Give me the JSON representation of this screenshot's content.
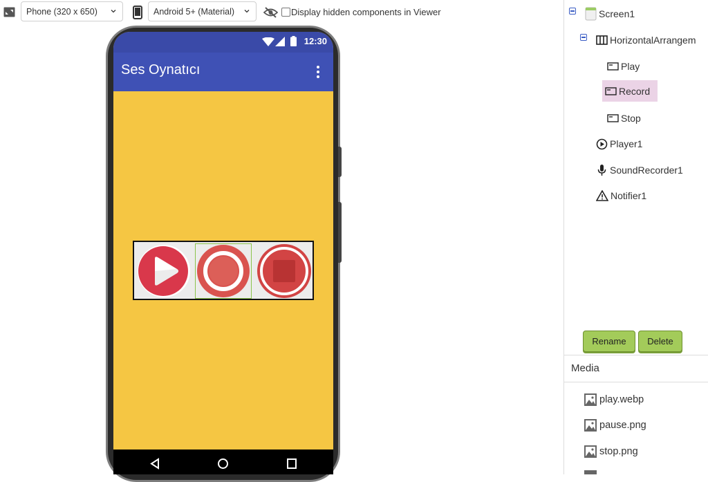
{
  "toolbar": {
    "device_select": "Phone (320 x 650)",
    "theme_select": "Android 5+ (Material)",
    "hidden_checkbox_label": "Display hidden components in Viewer",
    "hidden_checked": false
  },
  "phone": {
    "status_time": "12:30",
    "app_title": "Ses Oynatıcı",
    "colors": {
      "appbar": "#3f51b5",
      "statusbar": "#3a4aa8",
      "screen_bg": "#f5c643"
    }
  },
  "components_tree": {
    "items": [
      {
        "label": "Screen1",
        "icon": "screen-icon"
      },
      {
        "label": "HorizontalArrangem",
        "icon": "horizontal-arrangement-icon"
      },
      {
        "label": "Play",
        "icon": "button-icon"
      },
      {
        "label": "Record",
        "icon": "button-icon",
        "selected": true
      },
      {
        "label": "Stop",
        "icon": "button-icon"
      },
      {
        "label": "Player1",
        "icon": "player-icon"
      },
      {
        "label": "SoundRecorder1",
        "icon": "microphone-icon"
      },
      {
        "label": "Notifier1",
        "icon": "warning-icon"
      }
    ],
    "rename_label": "Rename",
    "delete_label": "Delete"
  },
  "media": {
    "header": "Media",
    "items": [
      {
        "label": "play.webp",
        "icon": "image-icon"
      },
      {
        "label": "pause.png",
        "icon": "image-icon"
      },
      {
        "label": "stop.png",
        "icon": "image-icon"
      }
    ]
  }
}
